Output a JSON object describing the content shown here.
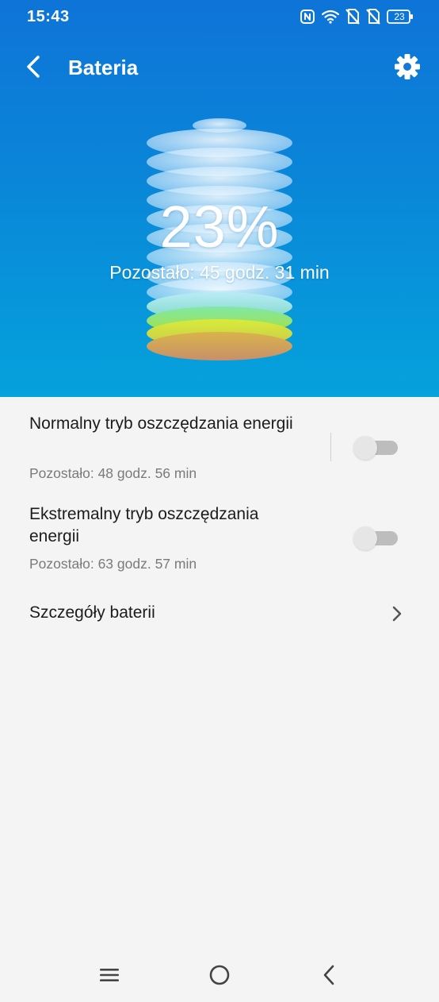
{
  "status_bar": {
    "time": "15:43",
    "battery_level": "23",
    "icons": [
      "nfc-icon",
      "wifi-icon",
      "no-sim-icon",
      "no-sim-icon",
      "battery-icon"
    ]
  },
  "app_bar": {
    "title": "Bateria",
    "back_icon": "back-arrow-icon",
    "settings_icon": "gear-icon"
  },
  "battery": {
    "percent": "23%",
    "remaining": "Pozostało: 45 godz. 31 min",
    "fill_level": 0.23
  },
  "settings": [
    {
      "title": "Normalny tryb oszczędzania energii",
      "subtitle": "Pozostało: 48 godz. 56 min",
      "enabled": false
    },
    {
      "title": "Ekstremalny tryb oszczędzania energii",
      "subtitle": "Pozostało: 63 godz. 57 min",
      "enabled": false
    }
  ],
  "details": {
    "label": "Szczegóły baterii",
    "icon": "chevron-right-icon"
  },
  "nav_bar": {
    "icons": [
      "menu-icon",
      "home-icon",
      "back-icon"
    ]
  },
  "colors": {
    "header_top": "#0e74d8",
    "header_bottom": "#05a2dc",
    "background": "#f4f4f4",
    "toggle_off_track": "#bdbdbd"
  }
}
